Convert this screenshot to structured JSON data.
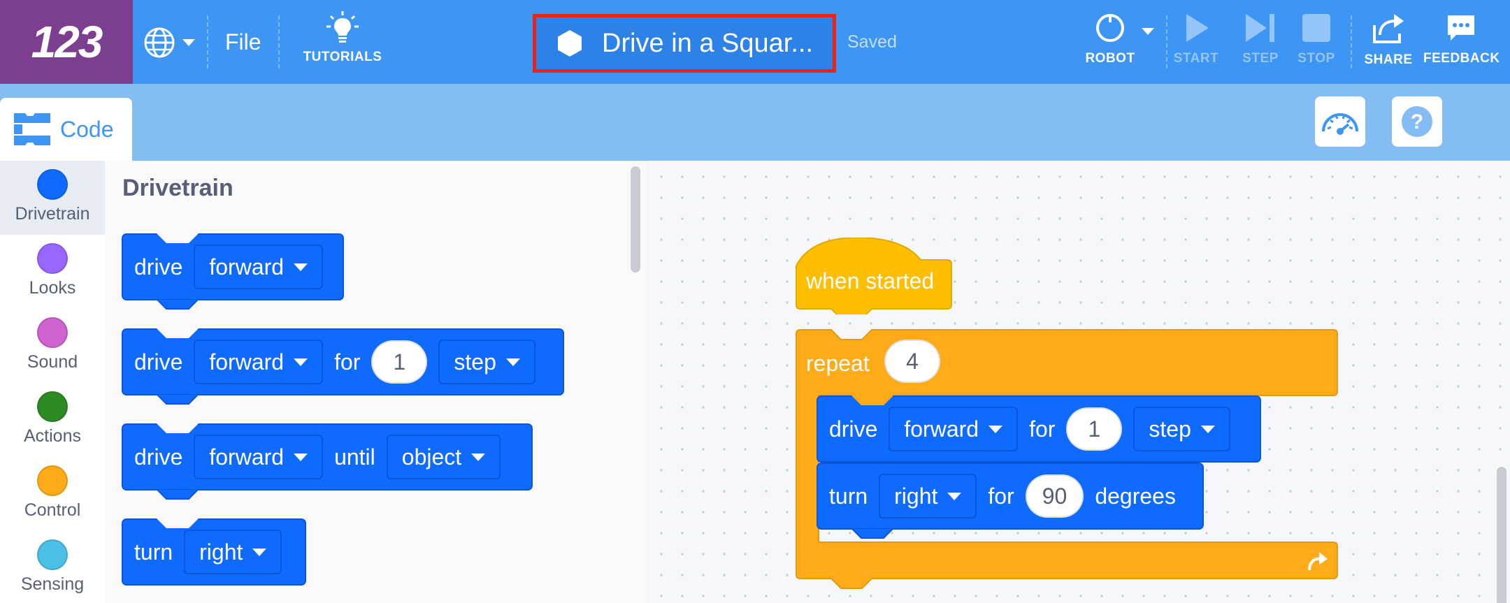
{
  "app": {
    "logo": "123",
    "file_menu": "File",
    "tutorials": "TUTORIALS",
    "project_title": "Drive in a Squar...",
    "save_status": "Saved",
    "accent_color": "#3d95f4",
    "highlight_color": "#e8231a"
  },
  "toolbar": {
    "robot": "ROBOT",
    "start": "START",
    "step": "STEP",
    "stop": "STOP",
    "share": "SHARE",
    "feedback": "FEEDBACK"
  },
  "tabs": {
    "code": "Code"
  },
  "categories": [
    {
      "label": "Drivetrain",
      "color": "#0f6bff"
    },
    {
      "label": "Looks",
      "color": "#9966ff"
    },
    {
      "label": "Sound",
      "color": "#cf63cf"
    },
    {
      "label": "Actions",
      "color": "#2e8b23"
    },
    {
      "label": "Control",
      "color": "#ffab19"
    },
    {
      "label": "Sensing",
      "color": "#4cbfe6"
    }
  ],
  "palette": {
    "title": "Drivetrain",
    "blocks": [
      {
        "kw": "drive",
        "dir": "forward"
      },
      {
        "kw": "drive",
        "dir": "forward",
        "for": "for",
        "amount": "1",
        "unit": "step"
      },
      {
        "kw": "drive",
        "dir": "forward",
        "until": "until",
        "target": "object"
      },
      {
        "kw": "turn",
        "dir": "right"
      }
    ]
  },
  "script": {
    "hat": "when started",
    "repeat_kw": "repeat",
    "repeat_count": "4",
    "drive": {
      "kw": "drive",
      "dir": "forward",
      "for": "for",
      "amount": "1",
      "unit": "step"
    },
    "turn": {
      "kw": "turn",
      "dir": "right",
      "for": "for",
      "amount": "90",
      "unit": "degrees"
    }
  }
}
